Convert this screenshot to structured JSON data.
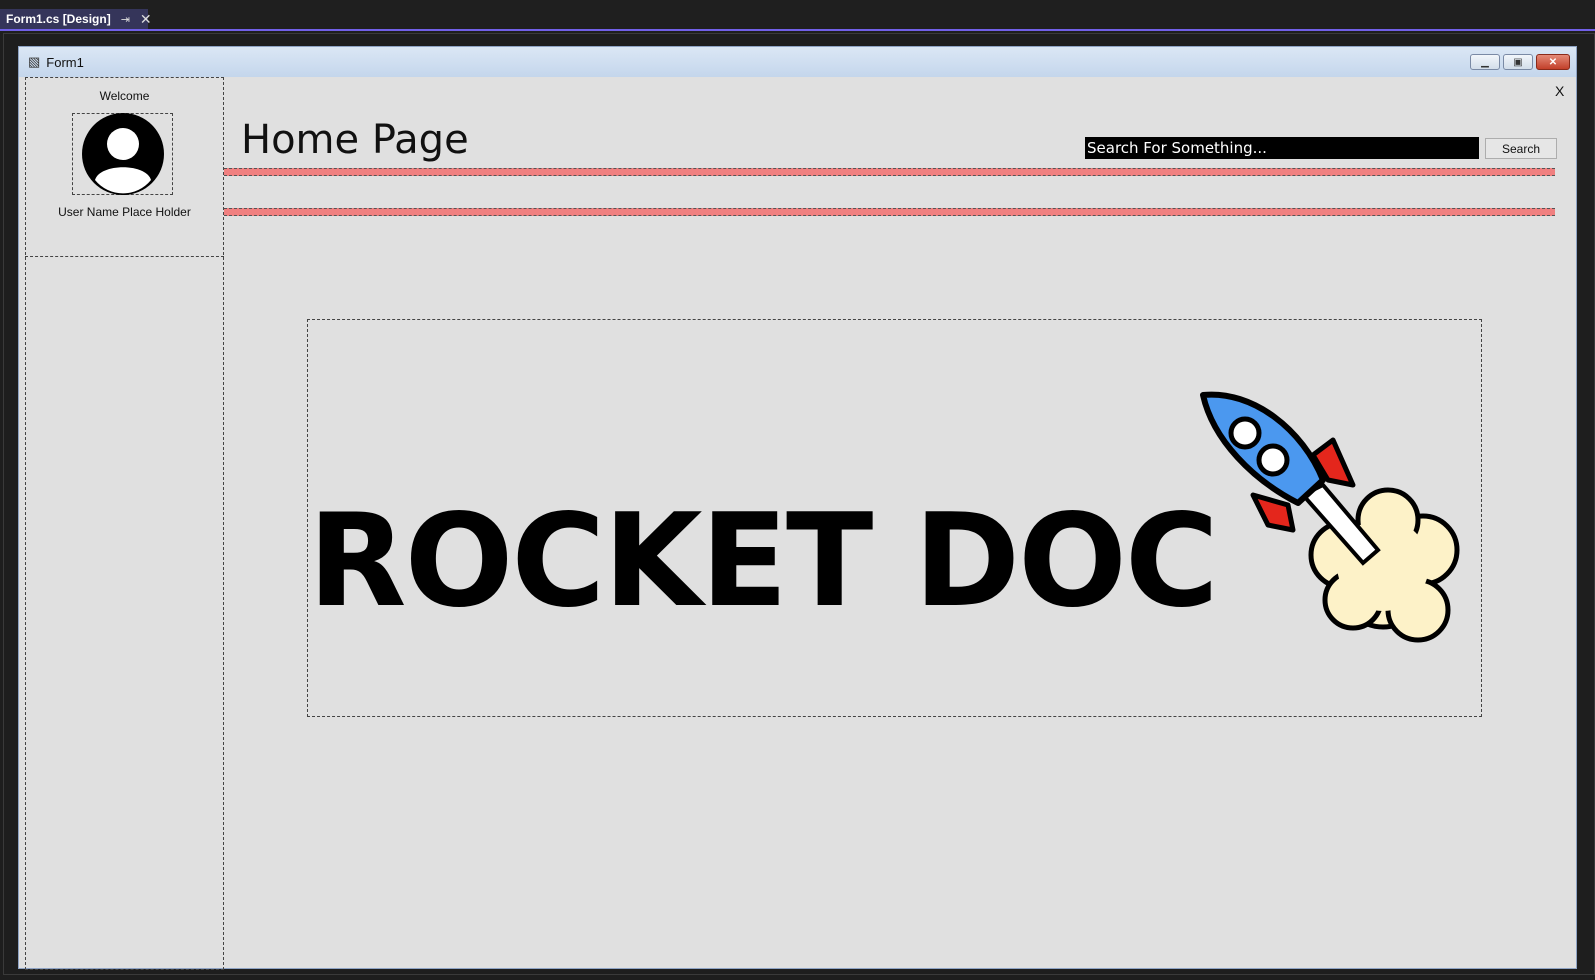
{
  "ide": {
    "tab_title": "Form1.cs [Design]",
    "pin_icon": "pin-icon",
    "close_icon": "close-icon"
  },
  "form": {
    "title": "Form1",
    "icon": "form-icon",
    "window_buttons": [
      "minimize",
      "restore",
      "close"
    ]
  },
  "sidebar": {
    "welcome": "Welcome",
    "avatar_icon": "user-avatar-icon",
    "username": "User Name Place Holder"
  },
  "header": {
    "title": "Home Page",
    "close_label": "X",
    "search_placeholder": "Search For Something...",
    "search_button": "Search"
  },
  "logo": {
    "text": "ROCKET DOC",
    "image": "rocket-icon"
  },
  "colors": {
    "divider": "#f08080",
    "form_background": "#e0e0e0",
    "search_background": "#000000",
    "ide_accent": "#7160e8"
  }
}
